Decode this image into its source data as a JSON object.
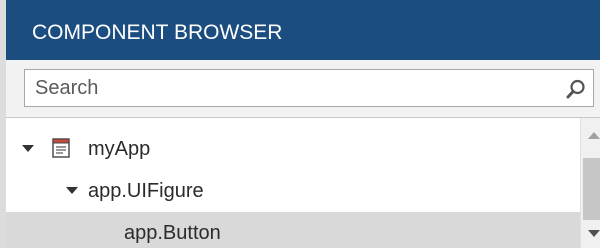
{
  "panel": {
    "title": "COMPONENT BROWSER",
    "header_color": "#1c4d80"
  },
  "search": {
    "placeholder": "Search",
    "value": "",
    "icon": "search-icon"
  },
  "tree": {
    "nodes": [
      {
        "label": "myApp",
        "level": 0,
        "expanded": true,
        "icon": "app-icon",
        "selected": false
      },
      {
        "label": "app.UIFigure",
        "level": 1,
        "expanded": true,
        "icon": null,
        "selected": false
      },
      {
        "label": "app.Button",
        "level": 2,
        "expanded": null,
        "icon": null,
        "selected": true
      }
    ]
  },
  "scrollbar": {
    "up_icon": "chevron-up-icon",
    "down_icon": "chevron-down-icon"
  }
}
